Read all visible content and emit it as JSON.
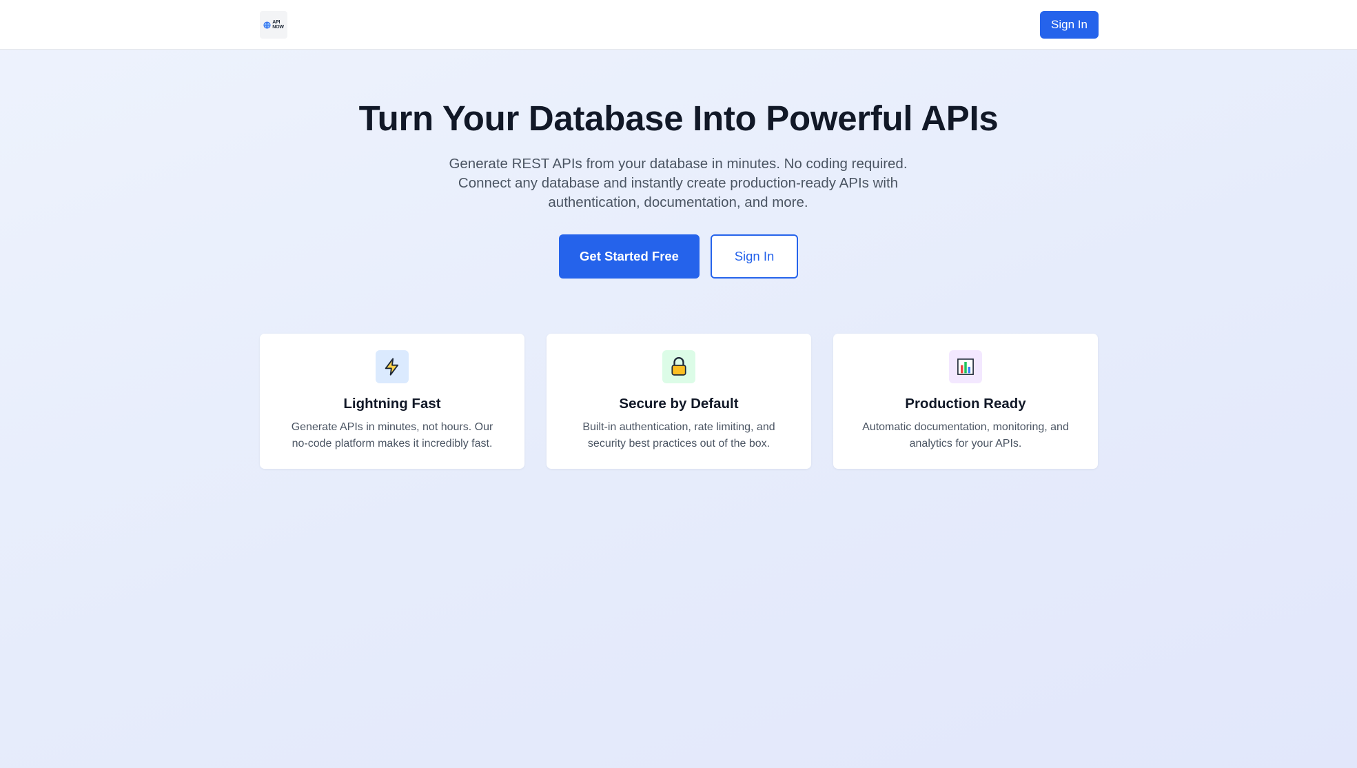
{
  "nav": {
    "logo_text_line1": "API",
    "logo_text_line2": "NOW",
    "sign_in_label": "Sign In"
  },
  "hero": {
    "title": "Turn Your Database Into Powerful APIs",
    "subtitle_line1": "Generate REST APIs from your database in minutes. No coding required.",
    "subtitle_line2": "Connect any database and instantly create production-ready APIs with",
    "subtitle_line3": "authentication, documentation, and more.",
    "primary_cta": "Get Started Free",
    "secondary_cta": "Sign In"
  },
  "features": [
    {
      "icon": "lightning-icon",
      "title": "Lightning Fast",
      "desc_line1": "Generate APIs in minutes, not hours. Our",
      "desc_line2": "no-code platform makes it incredibly fast."
    },
    {
      "icon": "lock-icon",
      "title": "Secure by Default",
      "desc_line1": "Built-in authentication, rate limiting, and",
      "desc_line2": "security best practices out of the box."
    },
    {
      "icon": "bar-chart-icon",
      "title": "Production Ready",
      "desc_line1": "Automatic documentation, monitoring, and",
      "desc_line2": "analytics for your APIs."
    }
  ],
  "colors": {
    "primary": "#2563eb",
    "heading": "#111827",
    "body_text": "#4b5563",
    "icon_bg_blue": "#dbeafe",
    "icon_bg_green": "#dcfce7",
    "icon_bg_purple": "#f3e8ff"
  }
}
